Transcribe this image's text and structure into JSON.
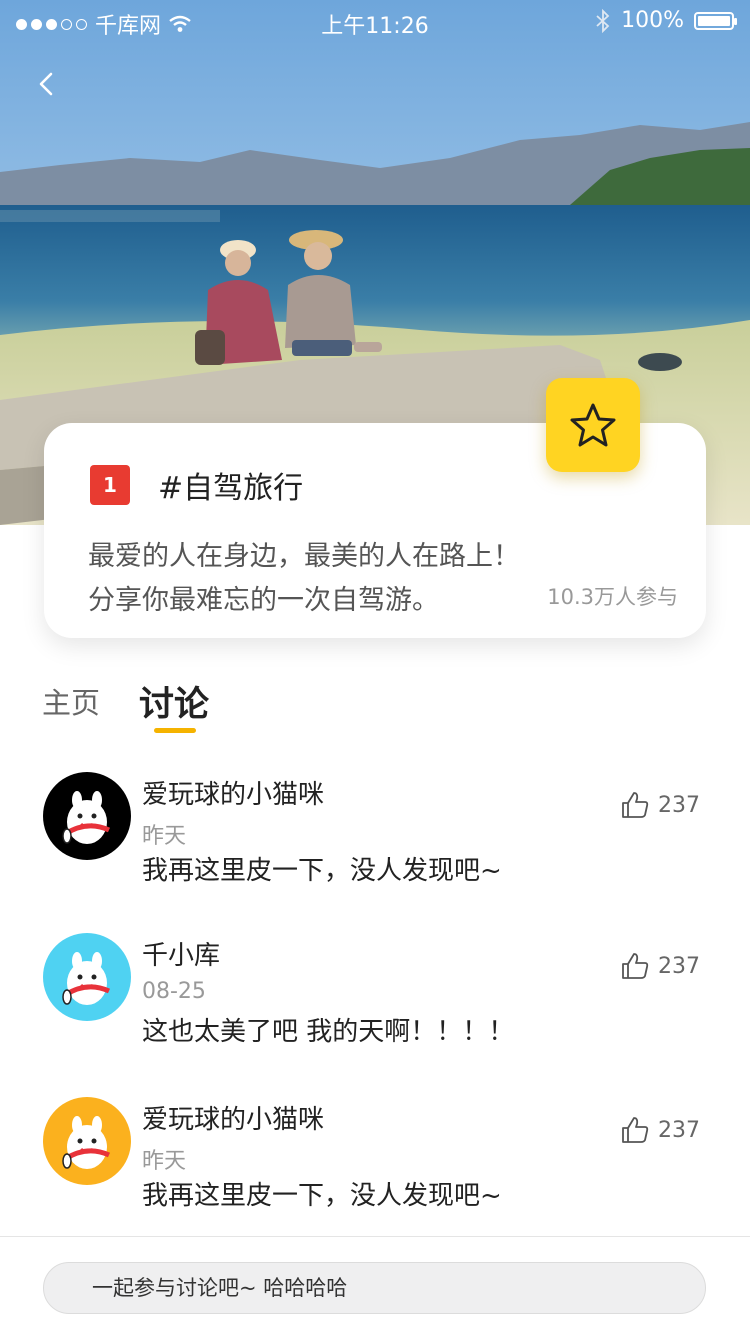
{
  "status_bar": {
    "carrier": "千库网",
    "time": "上午11:26",
    "battery": "100%"
  },
  "topic": {
    "rank": "1",
    "title": "#自驾旅行",
    "desc_line1": "最爱的人在身边，最美的人在路上！",
    "desc_line2": "分享你最难忘的一次自驾游。",
    "participants": "10.3万人参与"
  },
  "tabs": [
    {
      "label": "主页",
      "active": false
    },
    {
      "label": "讨论",
      "active": true
    }
  ],
  "comments": [
    {
      "name": "爱玩球的小猫咪",
      "date": "昨天",
      "text": "我再这里皮一下，没人发现吧~",
      "likes": "237",
      "avatar_color": "#000000"
    },
    {
      "name": "千小库",
      "date": "08-25",
      "text": "这也太美了吧  我的天啊！！！！",
      "likes": "237",
      "avatar_color": "#4fd2f2"
    },
    {
      "name": "爱玩球的小猫咪",
      "date": "昨天",
      "text": "我再这里皮一下，没人发现吧~",
      "likes": "237",
      "avatar_color": "#fbb11e"
    }
  ],
  "input": {
    "placeholder": "一起参与讨论吧~ 哈哈哈哈"
  },
  "colors": {
    "accent_yellow": "#ffd422",
    "tab_underline": "#f5b300",
    "badge_red": "#e83b31"
  }
}
